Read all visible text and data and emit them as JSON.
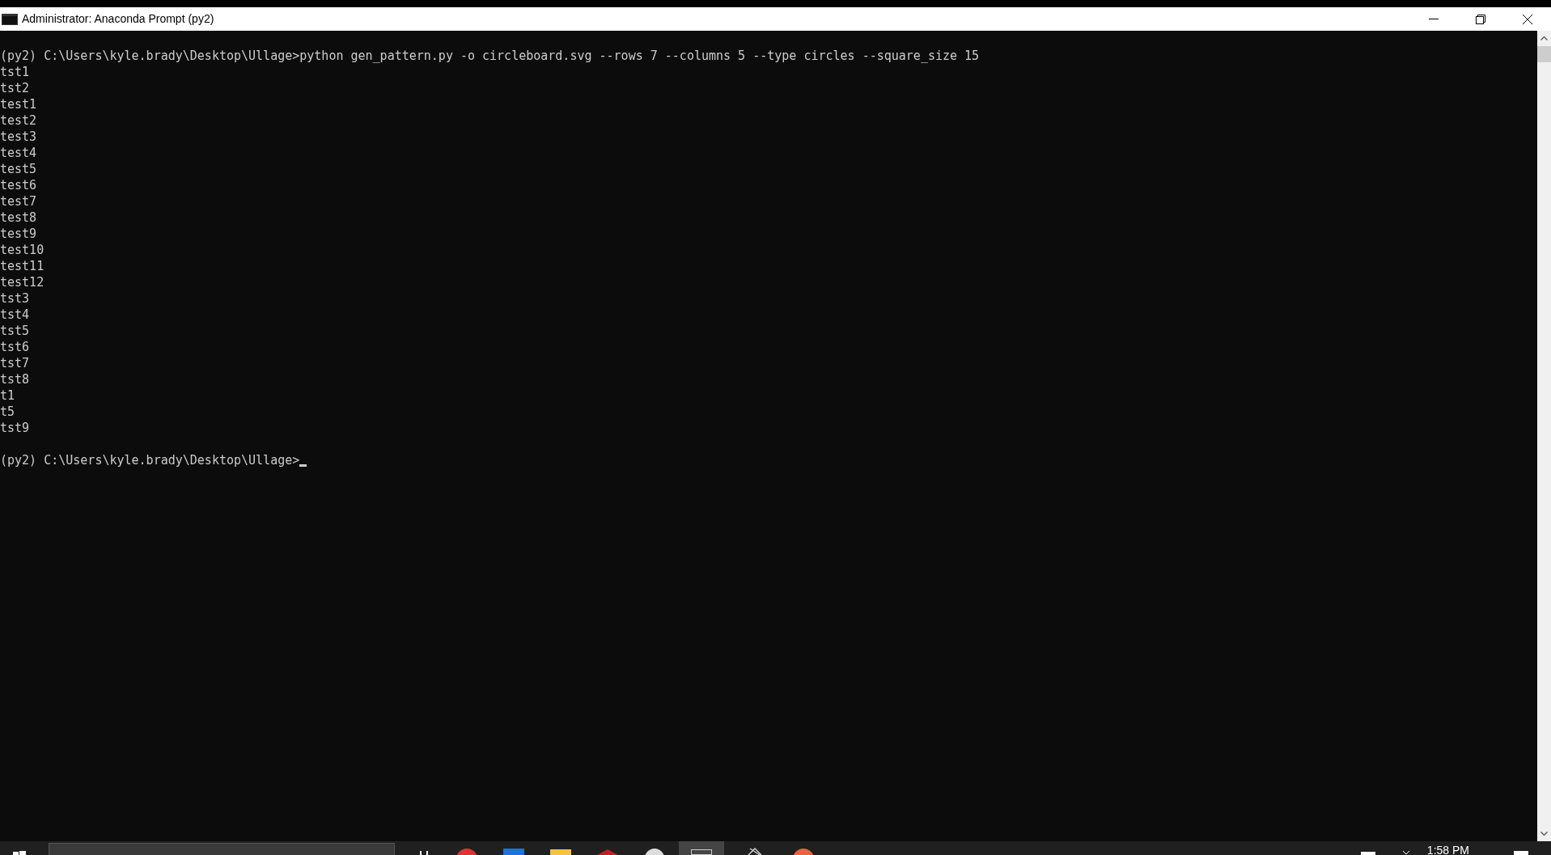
{
  "window": {
    "title": "Administrator: Anaconda Prompt (py2)"
  },
  "console": {
    "lines": [
      "(py2) C:\\Users\\kyle.brady\\Desktop\\Ullage>python gen_pattern.py -o circleboard.svg --rows 7 --columns 5 --type circles --square_size 15",
      "tst1",
      "tst2",
      "test1",
      "test2",
      "test3",
      "test4",
      "test5",
      "test6",
      "test7",
      "test8",
      "test9",
      "test10",
      "test11",
      "test12",
      "tst3",
      "tst4",
      "tst5",
      "tst6",
      "tst7",
      "tst8",
      "t1",
      "t5",
      "tst9"
    ],
    "prompt": "(py2) C:\\Users\\kyle.brady\\Desktop\\Ullage>"
  },
  "taskbar": {
    "clock": "1:58 PM"
  }
}
